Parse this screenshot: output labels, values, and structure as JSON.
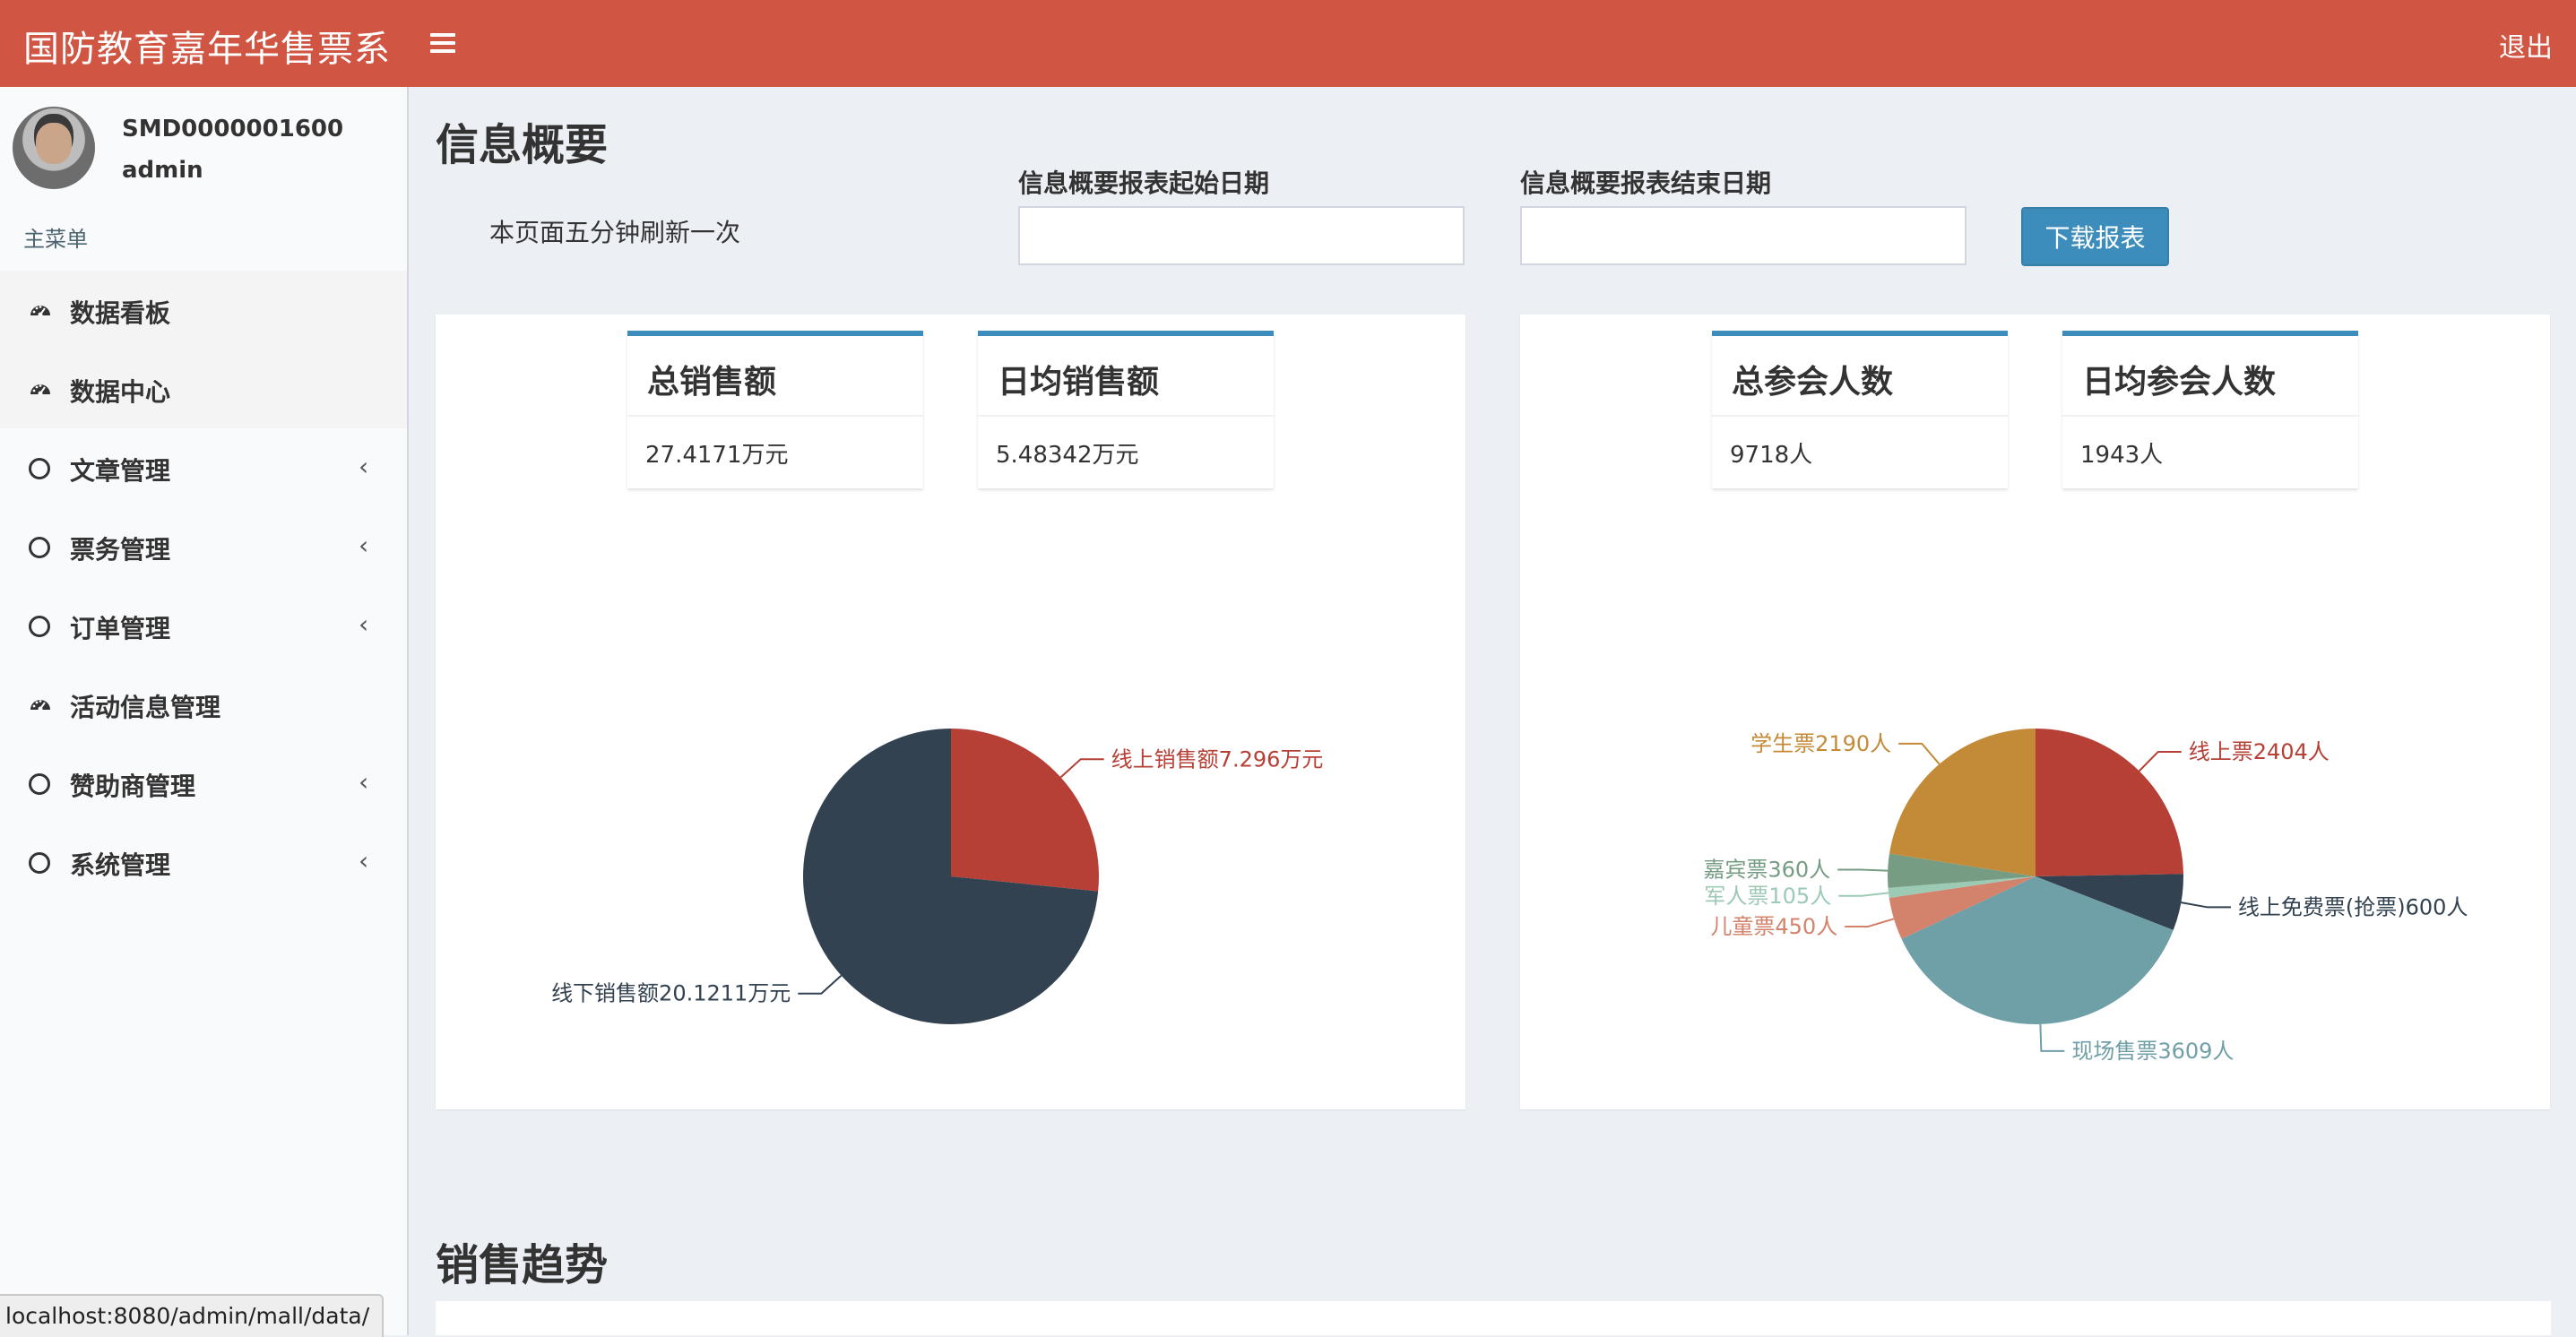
{
  "app": {
    "title": "国防教育嘉年华售票系",
    "logout_label": "退出"
  },
  "user": {
    "id": "SMD0000001600",
    "role": "admin"
  },
  "sidebar": {
    "header": "主菜单",
    "items": [
      {
        "label": "数据看板",
        "icon": "dashboard-icon",
        "has_submenu": false
      },
      {
        "label": "数据中心",
        "icon": "dashboard-icon",
        "has_submenu": false
      },
      {
        "label": "文章管理",
        "icon": "circle-icon",
        "has_submenu": true
      },
      {
        "label": "票务管理",
        "icon": "circle-icon",
        "has_submenu": true
      },
      {
        "label": "订单管理",
        "icon": "circle-icon",
        "has_submenu": true
      },
      {
        "label": "活动信息管理",
        "icon": "dashboard-icon",
        "has_submenu": false
      },
      {
        "label": "赞助商管理",
        "icon": "circle-icon",
        "has_submenu": true
      },
      {
        "label": "系统管理",
        "icon": "circle-icon",
        "has_submenu": true
      }
    ]
  },
  "main": {
    "title": "信息概要",
    "refresh_note": "本页面五分钟刷新一次",
    "start_date_label": "信息概要报表起始日期",
    "start_date_value": "",
    "end_date_label": "信息概要报表结束日期",
    "end_date_value": "",
    "download_label": "下载报表",
    "sales_stats": [
      {
        "title": "总销售额",
        "value": "27.4171万元"
      },
      {
        "title": "日均销售额",
        "value": "5.48342万元"
      }
    ],
    "attendance_stats": [
      {
        "title": "总参会人数",
        "value": "9718人"
      },
      {
        "title": "日均参会人数",
        "value": "1943人"
      }
    ],
    "trend_title": "销售趋势"
  },
  "status_bar": {
    "url": "localhost:8080/admin/mall/data/"
  },
  "colors": {
    "header": "#d05542",
    "primary_button": "#3c8dbc",
    "sidebar_bg": "#f9fafc",
    "content_bg": "#ecf0f5"
  },
  "chart_data": [
    {
      "type": "pie",
      "title": "",
      "slices": [
        {
          "label": "线上销售额7.296万元",
          "value": 7.296,
          "color": "#b63f36"
        },
        {
          "label": "线下销售额20.1211万元",
          "value": 20.1211,
          "color": "#334250"
        }
      ]
    },
    {
      "type": "pie",
      "title": "",
      "slices": [
        {
          "label": "线上票2404人",
          "value": 2404,
          "color": "#b63f36"
        },
        {
          "label": "线上免费票(抢票)600人",
          "value": 600,
          "color": "#334250"
        },
        {
          "label": "现场售票3609人",
          "value": 3609,
          "color": "#6f9fa7"
        },
        {
          "label": "儿童票450人",
          "value": 450,
          "color": "#d3826c"
        },
        {
          "label": "军人票105人",
          "value": 105,
          "color": "#9dcab4"
        },
        {
          "label": "嘉宾票360人",
          "value": 360,
          "color": "#769d83"
        },
        {
          "label": "学生票2190人",
          "value": 2190,
          "color": "#c38a37"
        }
      ]
    }
  ]
}
